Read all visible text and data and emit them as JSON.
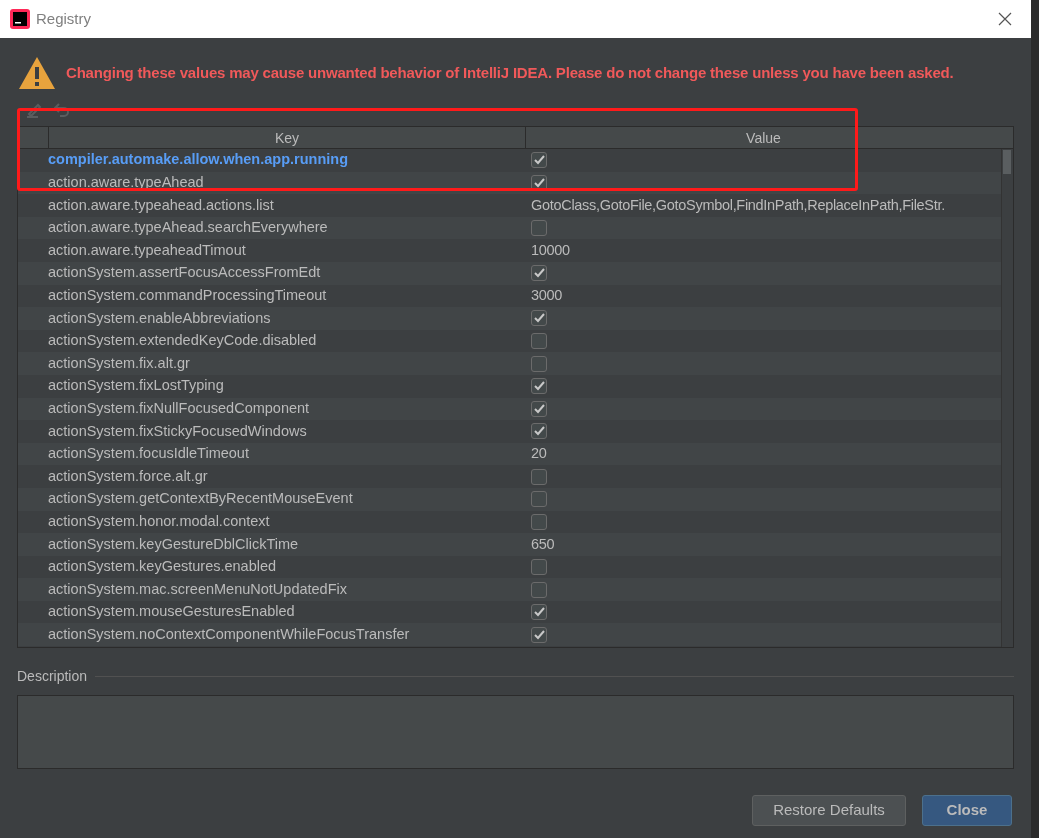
{
  "window": {
    "title": "Registry"
  },
  "warning": "Changing these values may cause unwanted behavior of IntelliJ IDEA. Please do not change these unless you have been asked.",
  "table": {
    "columns": [
      "Key",
      "Value"
    ],
    "rows": [
      {
        "key": "compiler.automake.allow.when.app.running",
        "kind": "bool",
        "checked": true,
        "modified": true
      },
      {
        "key": "action.aware.typeAhead",
        "kind": "bool",
        "checked": true,
        "modified": false
      },
      {
        "key": "action.aware.typeahead.actions.list",
        "kind": "text",
        "value": "GotoClass,GotoFile,GotoSymbol,FindInPath,ReplaceInPath,FileStr.",
        "modified": false
      },
      {
        "key": "action.aware.typeAhead.searchEverywhere",
        "kind": "bool",
        "checked": false,
        "modified": false
      },
      {
        "key": "action.aware.typeaheadTimout",
        "kind": "text",
        "value": "10000",
        "modified": false
      },
      {
        "key": "actionSystem.assertFocusAccessFromEdt",
        "kind": "bool",
        "checked": true,
        "modified": false
      },
      {
        "key": "actionSystem.commandProcessingTimeout",
        "kind": "text",
        "value": "3000",
        "modified": false
      },
      {
        "key": "actionSystem.enableAbbreviations",
        "kind": "bool",
        "checked": true,
        "modified": false
      },
      {
        "key": "actionSystem.extendedKeyCode.disabled",
        "kind": "bool",
        "checked": false,
        "modified": false
      },
      {
        "key": "actionSystem.fix.alt.gr",
        "kind": "bool",
        "checked": false,
        "modified": false
      },
      {
        "key": "actionSystem.fixLostTyping",
        "kind": "bool",
        "checked": true,
        "modified": false
      },
      {
        "key": "actionSystem.fixNullFocusedComponent",
        "kind": "bool",
        "checked": true,
        "modified": false
      },
      {
        "key": "actionSystem.fixStickyFocusedWindows",
        "kind": "bool",
        "checked": true,
        "modified": false
      },
      {
        "key": "actionSystem.focusIdleTimeout",
        "kind": "text",
        "value": "20",
        "modified": false
      },
      {
        "key": "actionSystem.force.alt.gr",
        "kind": "bool",
        "checked": false,
        "modified": false
      },
      {
        "key": "actionSystem.getContextByRecentMouseEvent",
        "kind": "bool",
        "checked": false,
        "modified": false
      },
      {
        "key": "actionSystem.honor.modal.context",
        "kind": "bool",
        "checked": false,
        "modified": false
      },
      {
        "key": "actionSystem.keyGestureDblClickTime",
        "kind": "text",
        "value": "650",
        "modified": false
      },
      {
        "key": "actionSystem.keyGestures.enabled",
        "kind": "bool",
        "checked": false,
        "modified": false
      },
      {
        "key": "actionSystem.mac.screenMenuNotUpdatedFix",
        "kind": "bool",
        "checked": false,
        "modified": false
      },
      {
        "key": "actionSystem.mouseGesturesEnabled",
        "kind": "bool",
        "checked": true,
        "modified": false
      },
      {
        "key": "actionSystem.noContextComponentWhileFocusTransfer",
        "kind": "bool",
        "checked": true,
        "modified": false
      }
    ]
  },
  "description": {
    "label": "Description"
  },
  "buttons": [
    {
      "label": "Restore Defaults",
      "primary": false
    },
    {
      "label": "Close",
      "primary": true
    }
  ]
}
